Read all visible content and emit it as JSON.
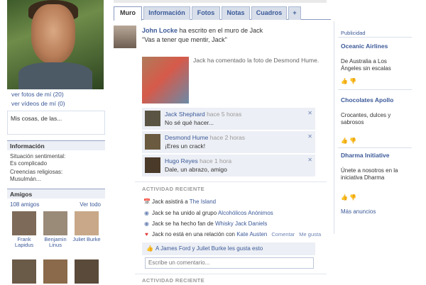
{
  "left": {
    "photos_link": "ver fotos de mí (20)",
    "videos_link": "ver vídeos de mí (0)",
    "bio": "Mis cosas, de las...",
    "info_title": "Información",
    "info_lines": [
      "Situación sentimental:",
      "Es complicado",
      "Creencias religiosas:",
      "Musulmán..."
    ],
    "friends_title": "Amigos",
    "friends_count": "108 amigos",
    "see_all": "Ver todo",
    "friends": [
      {
        "name": "Frank Lapidus"
      },
      {
        "name": "Benjamin Linus"
      },
      {
        "name": "Juliet Burke"
      }
    ]
  },
  "tabs": [
    "Muro",
    "Información",
    "Fotos",
    "Notas",
    "Cuadros",
    "+"
  ],
  "wall": {
    "author": "John Locke",
    "head_suffix": "ha escrito en el muro de Jack",
    "quote": "\"Vas a tener que mentir, Jack\"",
    "tagged_text": "Jack ha comentado la foto de Desmond Hume.",
    "comments": [
      {
        "name": "Jack Shephard",
        "time": "hace 5 horas",
        "text": "No sé qué hacer..."
      },
      {
        "name": "Desmond Hume",
        "time": "hace 2 horas",
        "text": "¡Eres un crack!"
      },
      {
        "name": "Hugo Reyes",
        "time": "hace 1 hora",
        "text": "Dale, un abrazo, amigo"
      }
    ],
    "recent_title": "ACTIVIDAD RECIENTE",
    "activities": [
      {
        "icon": "calendar",
        "text": "Jack asistirá a",
        "link": "The Island"
      },
      {
        "icon": "group",
        "text": "Jack se ha unido al grupo",
        "link": "Alcohólicos Anónimos"
      },
      {
        "icon": "group",
        "text": "Jack se ha hecho fan de",
        "link": "Whisky Jack Daniels"
      },
      {
        "icon": "heart",
        "text": "Jack no está en una relación con",
        "link": "Kate Austen",
        "meta1": "Comentar",
        "meta2": "Me gusta"
      }
    ],
    "likes_text": "A James Ford y Juliet Burke les gusta esto",
    "comment_placeholder": "Escribe un comentario...",
    "recent_title2": "ACTIVIDAD RECIENTE"
  },
  "ads": {
    "label": "Publicidad",
    "items": [
      {
        "title": "Oceanic Airlines",
        "body": "De Australia a Los Ángeles sin escalas"
      },
      {
        "title": "Chocolates Apollo",
        "body": "Crocantes, dulces y sabrosos"
      },
      {
        "title": "Dharma Initiative",
        "body": "Únete a nosotros en la iniciativa Dharma"
      }
    ],
    "more": "Más anuncios"
  }
}
